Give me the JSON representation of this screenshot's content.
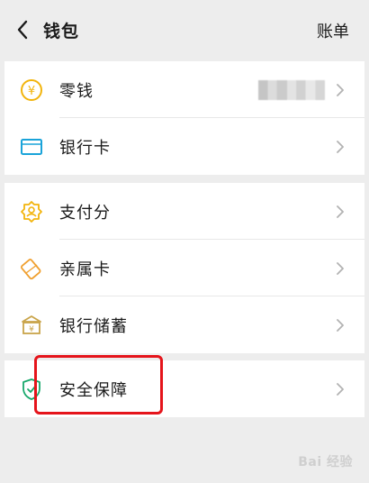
{
  "header": {
    "title": "钱包",
    "right_action": "账单"
  },
  "groups": [
    {
      "items": [
        {
          "label": "零钱",
          "icon": "coin-icon",
          "value_blurred": true
        },
        {
          "label": "银行卡",
          "icon": "bank-card-icon"
        }
      ]
    },
    {
      "items": [
        {
          "label": "支付分",
          "icon": "pay-score-icon"
        },
        {
          "label": "亲属卡",
          "icon": "family-card-icon"
        },
        {
          "label": "银行储蓄",
          "icon": "bank-savings-icon"
        }
      ]
    },
    {
      "items": [
        {
          "label": "安全保障",
          "icon": "shield-icon",
          "highlighted": true
        }
      ]
    }
  ],
  "watermark": {
    "text": "Bai 经验"
  },
  "colors": {
    "accent_yellow": "#f2b40c",
    "accent_blue": "#1aa3d9",
    "accent_orange": "#f0a030",
    "shield_green": "#17a86b",
    "highlight_red": "#e5141b",
    "background": "#ededed"
  }
}
